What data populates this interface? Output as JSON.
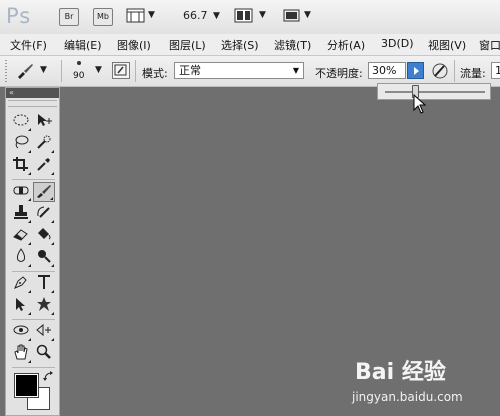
{
  "app": {
    "logo": "Ps",
    "br_label": "Br",
    "mb_label": "Mb",
    "zoom": "66.7"
  },
  "menu": {
    "items": [
      "文件(F)",
      "编辑(E)",
      "图像(I)",
      "图层(L)",
      "选择(S)",
      "滤镜(T)",
      "分析(A)",
      "3D(D)",
      "视图(V)",
      "窗口"
    ]
  },
  "options": {
    "brush_size": "90",
    "mode_label": "模式:",
    "mode_value": "正常",
    "opacity_label": "不透明度:",
    "opacity_value": "30%",
    "opacity_level": 0.3,
    "flow_label": "流量:",
    "flow_value": "1"
  },
  "toolbox": {
    "collapse_glyph": "«"
  },
  "watermark": {
    "logo": "Bai 经验",
    "url": "jingyan.baidu.com"
  }
}
